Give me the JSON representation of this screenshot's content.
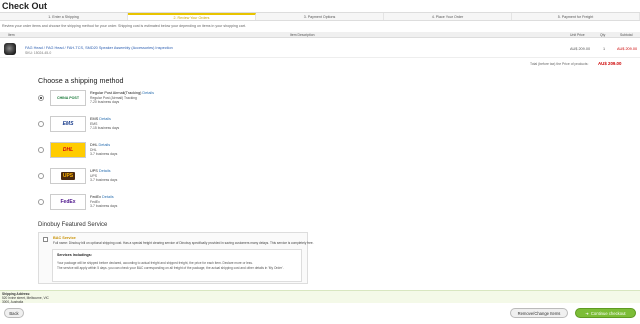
{
  "page_title": "Check Out",
  "steps": [
    "1. Enter a Shipping",
    "2. Review Your Orders",
    "3. Payment Options",
    "4. Place Your Order",
    "5. Payment for Freight"
  ],
  "intro": "Review your order items and choose the shipping method for your order. Shipping cost is estimated below your depending on items in your shopping cart.",
  "table_headers": {
    "item": "Item",
    "description": "Item Description",
    "unit_price": "Unit Price",
    "qty": "Qty",
    "subtotal": "Subtotal"
  },
  "item": {
    "name": "FAG Head / FAG Head / FAH-TCS, SMD20 Speaker Assembly (Accessories) Inspection",
    "sku": "SKU: 15024-45-0",
    "unit_price": "AU$ 209.00",
    "qty": "1",
    "subtotal": "AU$ 209.00"
  },
  "subtotal": {
    "label": "Total (before tax) the Price of products:",
    "value": "AU$ 209.00"
  },
  "shipping": {
    "heading": "Choose a shipping method",
    "options": [
      {
        "name": "Regular Post Airmail(Tracking)",
        "link": "Details",
        "line2": "Regular Post (Airmail) Tracking",
        "line3": "7-20 business days",
        "logo": "CHINA POST",
        "logo_color": "#1a7a3a",
        "selected": true
      },
      {
        "name": "EMS",
        "link": "Details",
        "line2": "EMS",
        "line3": "7-15 business days",
        "logo": "EMS",
        "logo_color": "#1a3d8c",
        "selected": false
      },
      {
        "name": "DHL",
        "link": "Details",
        "line2": "DHL",
        "line3": "3-7 business days",
        "logo": "DHL",
        "logo_color": "#d40511",
        "selected": false
      },
      {
        "name": "UPS",
        "link": "Details",
        "line2": "UPS",
        "line3": "3-7 business days",
        "logo": "UPS",
        "logo_color": "#ffb500",
        "selected": false
      },
      {
        "name": "FedEx",
        "link": "Details",
        "line2": "FedEx",
        "line3": "3-7 business days",
        "logo": "FedEx",
        "logo_color": "#4d148c",
        "selected": false
      }
    ]
  },
  "featured": {
    "heading": "Dinobuy Featured Service",
    "service_name": "BAC Service",
    "description": "Full name: Dinobuy bill on optional shipping cost. Has a special freight clearing service of Dinobuy specifically provided in saving customers many delays. This service is completely free.",
    "inner_title": "Services Includings:",
    "inner_lines": [
      "Your package will be shipped before declared, according to actual freight and shipped freight, the price for each item. Declare more or less.",
      "The service will apply within 5 days. you can check your BAC corresponding on all freight of the package, the actual shipping cost and other details in 'My Order'."
    ]
  },
  "ship_address": {
    "label": "Shipping Address:",
    "line1": "520 Irvine street, Melbourne, VIC",
    "line2": "3000, Australia"
  },
  "buttons": {
    "back": "Back",
    "remove": "Remove/Change Items",
    "continue": "Continue checkout"
  }
}
